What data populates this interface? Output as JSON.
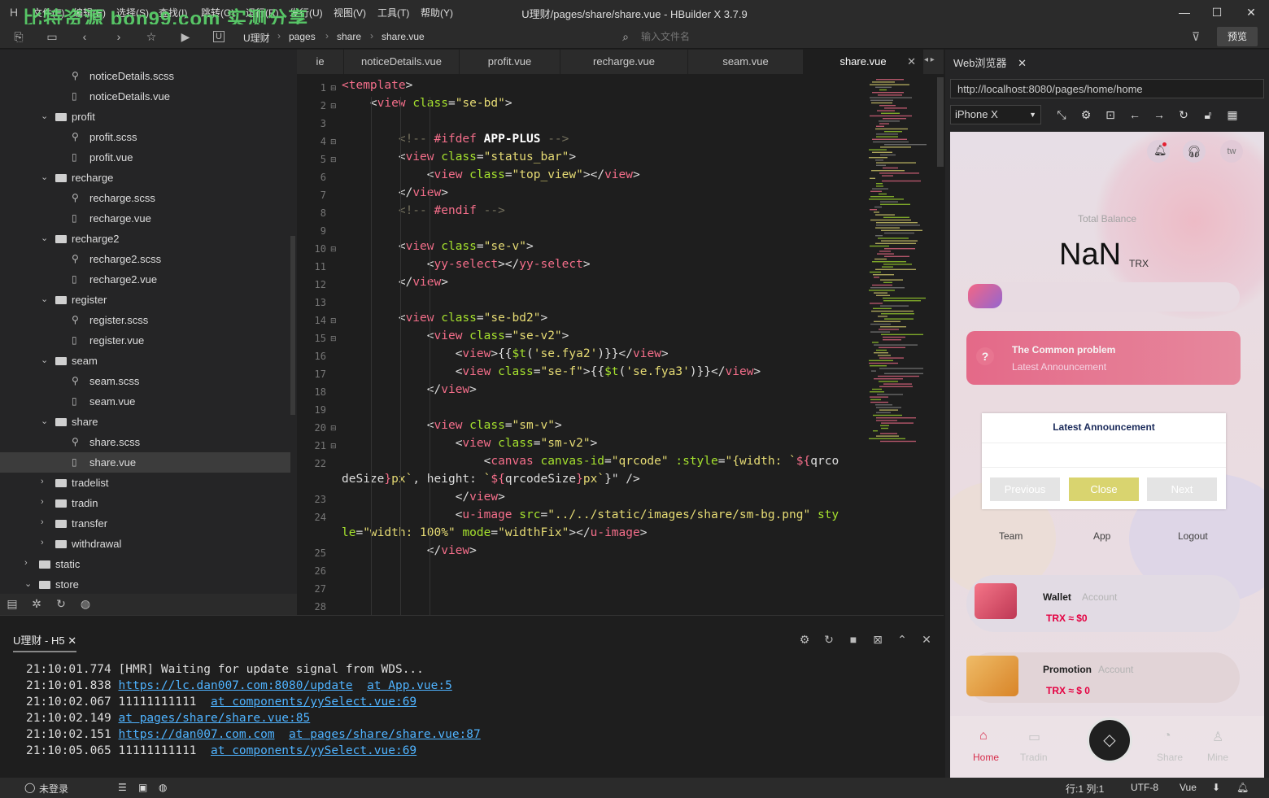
{
  "titlebar": {
    "watermark": "比特资源 bon99.com 实测分享",
    "menus": [
      "文件(F)",
      "编辑(E)",
      "选择(S)",
      "查找(I)",
      "跳转(G)",
      "运行(R)",
      "发行(U)",
      "视图(V)",
      "工具(T)",
      "帮助(Y)"
    ],
    "title": "U理财/pages/share/share.vue - HBuilder X 3.7.9"
  },
  "toolbar": {
    "breadcrumb": [
      "U理财",
      "pages",
      "share",
      "share.vue"
    ],
    "file_search_placeholder": "输入文件名",
    "preview_label": "预览"
  },
  "sidebar": {
    "items": [
      {
        "label": "noticeDetails.scss",
        "type": "scss",
        "depth": 2
      },
      {
        "label": "noticeDetails.vue",
        "type": "vue",
        "depth": 2
      },
      {
        "label": "profit",
        "type": "folder-open",
        "depth": 1
      },
      {
        "label": "profit.scss",
        "type": "scss",
        "depth": 2
      },
      {
        "label": "profit.vue",
        "type": "vue",
        "depth": 2
      },
      {
        "label": "recharge",
        "type": "folder-open",
        "depth": 1
      },
      {
        "label": "recharge.scss",
        "type": "scss",
        "depth": 2
      },
      {
        "label": "recharge.vue",
        "type": "vue",
        "depth": 2
      },
      {
        "label": "recharge2",
        "type": "folder-open",
        "depth": 1
      },
      {
        "label": "recharge2.scss",
        "type": "scss",
        "depth": 2
      },
      {
        "label": "recharge2.vue",
        "type": "vue",
        "depth": 2
      },
      {
        "label": "register",
        "type": "folder-open",
        "depth": 1
      },
      {
        "label": "register.scss",
        "type": "scss",
        "depth": 2
      },
      {
        "label": "register.vue",
        "type": "vue",
        "depth": 2
      },
      {
        "label": "seam",
        "type": "folder-open",
        "depth": 1
      },
      {
        "label": "seam.scss",
        "type": "scss",
        "depth": 2
      },
      {
        "label": "seam.vue",
        "type": "vue",
        "depth": 2
      },
      {
        "label": "share",
        "type": "folder-open",
        "depth": 1
      },
      {
        "label": "share.scss",
        "type": "scss",
        "depth": 2
      },
      {
        "label": "share.vue",
        "type": "vue",
        "depth": 2,
        "selected": true
      },
      {
        "label": "tradelist",
        "type": "folder-closed",
        "depth": 1
      },
      {
        "label": "tradin",
        "type": "folder-closed",
        "depth": 1
      },
      {
        "label": "transfer",
        "type": "folder-closed",
        "depth": 1
      },
      {
        "label": "withdrawal",
        "type": "folder-closed",
        "depth": 1
      },
      {
        "label": "static",
        "type": "folder-closed",
        "depth": 0
      },
      {
        "label": "store",
        "type": "folder-open",
        "depth": 0
      }
    ]
  },
  "editor": {
    "tabs": [
      {
        "label": "ie"
      },
      {
        "label": "noticeDetails.vue"
      },
      {
        "label": "profit.vue"
      },
      {
        "label": "recharge.vue"
      },
      {
        "label": "seam.vue"
      },
      {
        "label": "share.vue",
        "active": true
      }
    ],
    "line_numbers": [
      "1",
      "2",
      "3",
      "4",
      "5",
      "6",
      "7",
      "8",
      "9",
      "10",
      "11",
      "12",
      "13",
      "14",
      "15",
      "16",
      "17",
      "18",
      "19",
      "20",
      "21",
      "22",
      "",
      "23",
      "24",
      "",
      "25",
      "26",
      "27",
      "28"
    ]
  },
  "console": {
    "tab_label": "U理财 - H5",
    "lines": [
      {
        "time": "21:10:01.774",
        "text": "[HMR] Waiting for update signal from WDS...",
        "links": []
      },
      {
        "time": "21:10:01.838",
        "text": "",
        "links": [
          "https://lc.dan007.com:8080/update",
          "at App.vue:5"
        ]
      },
      {
        "time": "21:10:02.067",
        "text": "11111111111",
        "links": [
          "at components/yySelect.vue:69"
        ]
      },
      {
        "time": "21:10:02.149",
        "text": "",
        "links": [
          "at pages/share/share.vue:85"
        ]
      },
      {
        "time": "21:10:02.151",
        "text": "",
        "links": [
          "https://dan007.com.com",
          "at pages/share/share.vue:87"
        ]
      },
      {
        "time": "21:10:05.065",
        "text": "11111111111",
        "links": [
          "at components/yySelect.vue:69"
        ]
      }
    ]
  },
  "statusbar": {
    "login": "未登录",
    "position": "行:1  列:1",
    "encoding": "UTF-8",
    "language": "Vue"
  },
  "browser": {
    "tab_label": "Web浏览器",
    "url": "http://localhost:8080/pages/home/home",
    "device": "iPhone X",
    "phone": {
      "avatar_text": "tw",
      "total_balance_label": "Total Balance",
      "balance_value": "NaN",
      "balance_unit": "TRX",
      "problem_title": "The Common problem",
      "problem_subtitle": "Latest Announcement",
      "menu": [
        "Team",
        "App",
        "Logout"
      ],
      "wallet_title": "Wallet",
      "wallet_sub": "Account",
      "wallet_value": "TRX ≈ $0",
      "promo_title": "Promotion",
      "promo_sub": "Account",
      "promo_value": "TRX ≈ $ 0",
      "nav": [
        "Home",
        "Tradin",
        "Share",
        "Mine"
      ],
      "modal": {
        "title": "Latest Announcement",
        "previous": "Previous",
        "close": "Close",
        "next": "Next"
      }
    }
  }
}
